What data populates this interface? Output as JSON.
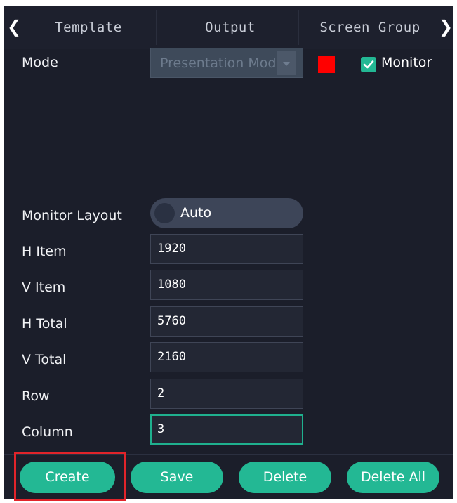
{
  "tabs": {
    "prev_arrow": "❮",
    "next_arrow": "❯",
    "items": [
      {
        "label": "Template"
      },
      {
        "label": "Output"
      },
      {
        "label": "Screen Group"
      }
    ]
  },
  "mode": {
    "label": "Mode",
    "select_value": "Presentation Mode",
    "swatch_color": "#ff0000",
    "monitor_checked": true,
    "monitor_label": "Monitor"
  },
  "monitor_layout": {
    "label": "Monitor Layout",
    "toggle_value": "Auto"
  },
  "fields": {
    "h_item": {
      "label": "H Item",
      "value": "1920"
    },
    "v_item": {
      "label": "V Item",
      "value": "1080"
    },
    "h_total": {
      "label": "H Total",
      "value": "5760"
    },
    "v_total": {
      "label": "V Total",
      "value": "2160"
    },
    "row": {
      "label": "Row",
      "value": "2"
    },
    "column": {
      "label": "Column",
      "value": "3"
    }
  },
  "buttons": {
    "create": "Create",
    "save": "Save",
    "delete": "Delete",
    "delete_all": "Delete All"
  },
  "colors": {
    "background": "#1b1e2a",
    "accent": "#23b894",
    "highlight": "#e1242a"
  }
}
